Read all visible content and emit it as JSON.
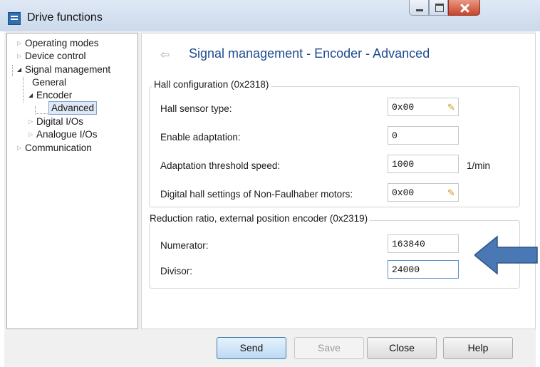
{
  "window": {
    "title": "Drive functions"
  },
  "tree": {
    "items": [
      {
        "label": "Operating modes"
      },
      {
        "label": "Device control"
      },
      {
        "label": "Signal management"
      },
      {
        "label": "General"
      },
      {
        "label": "Encoder"
      },
      {
        "label": "Advanced",
        "selected": true
      },
      {
        "label": "Digital I/Os"
      },
      {
        "label": "Analogue I/Os"
      },
      {
        "label": "Communication"
      }
    ]
  },
  "page": {
    "title": "Signal management - Encoder - Advanced"
  },
  "hall_group": {
    "label": "Hall configuration (0x2318)",
    "rows": [
      {
        "label": "Hall sensor type:",
        "value": "0x00"
      },
      {
        "label": "Enable adaptation:",
        "value": "0"
      },
      {
        "label": "Adaptation threshold speed:",
        "value": "1000",
        "unit": "1/min"
      },
      {
        "label": "Digital hall settings of Non-Faulhaber motors:",
        "value": "0x00"
      }
    ]
  },
  "reduction_group": {
    "label": "Reduction ratio, external position encoder (0x2319)",
    "rows": [
      {
        "label": "Numerator:",
        "value": "163840"
      },
      {
        "label": "Divisor:",
        "value": "24000"
      }
    ]
  },
  "buttons": {
    "send": "Send",
    "save": "Save",
    "close": "Close",
    "help": "Help"
  },
  "colors": {
    "title_text": "#1e4b8f",
    "arrow": "#3d6ea8"
  }
}
